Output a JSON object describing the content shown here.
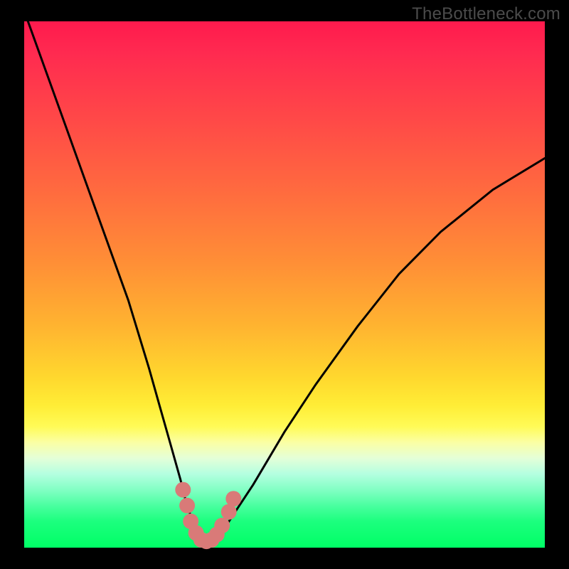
{
  "watermark": "TheBottleneck.com",
  "colors": {
    "frame": "#000000",
    "curve": "#000000",
    "marker": "#d97a78",
    "gradient_top": "#ff1a4d",
    "gradient_bottom": "#00ff66"
  },
  "chart_data": {
    "type": "line",
    "title": "",
    "xlabel": "",
    "ylabel": "",
    "xlim": [
      0,
      100
    ],
    "ylim": [
      0,
      100
    ],
    "series": [
      {
        "name": "bottleneck-curve",
        "x": [
          0,
          4,
          8,
          12,
          16,
          20,
          24,
          26,
          28,
          30,
          31,
          32,
          33,
          34,
          35,
          36,
          37,
          38,
          40,
          44,
          50,
          56,
          64,
          72,
          80,
          90,
          100
        ],
        "y": [
          102,
          91,
          80,
          69,
          58,
          47,
          34,
          27,
          20,
          13,
          9,
          6,
          3,
          1.5,
          1,
          1.2,
          2,
          3,
          6,
          12,
          22,
          31,
          42,
          52,
          60,
          68,
          74
        ]
      }
    ],
    "markers": [
      {
        "x": 30.5,
        "y": 11
      },
      {
        "x": 31.3,
        "y": 8
      },
      {
        "x": 32.0,
        "y": 5
      },
      {
        "x": 33.0,
        "y": 2.8
      },
      {
        "x": 34.0,
        "y": 1.5
      },
      {
        "x": 35.0,
        "y": 1.2
      },
      {
        "x": 36.0,
        "y": 1.5
      },
      {
        "x": 37.0,
        "y": 2.5
      },
      {
        "x": 38.0,
        "y": 4.2
      },
      {
        "x": 39.3,
        "y": 6.8
      },
      {
        "x": 40.2,
        "y": 9.3
      }
    ],
    "annotations": []
  }
}
